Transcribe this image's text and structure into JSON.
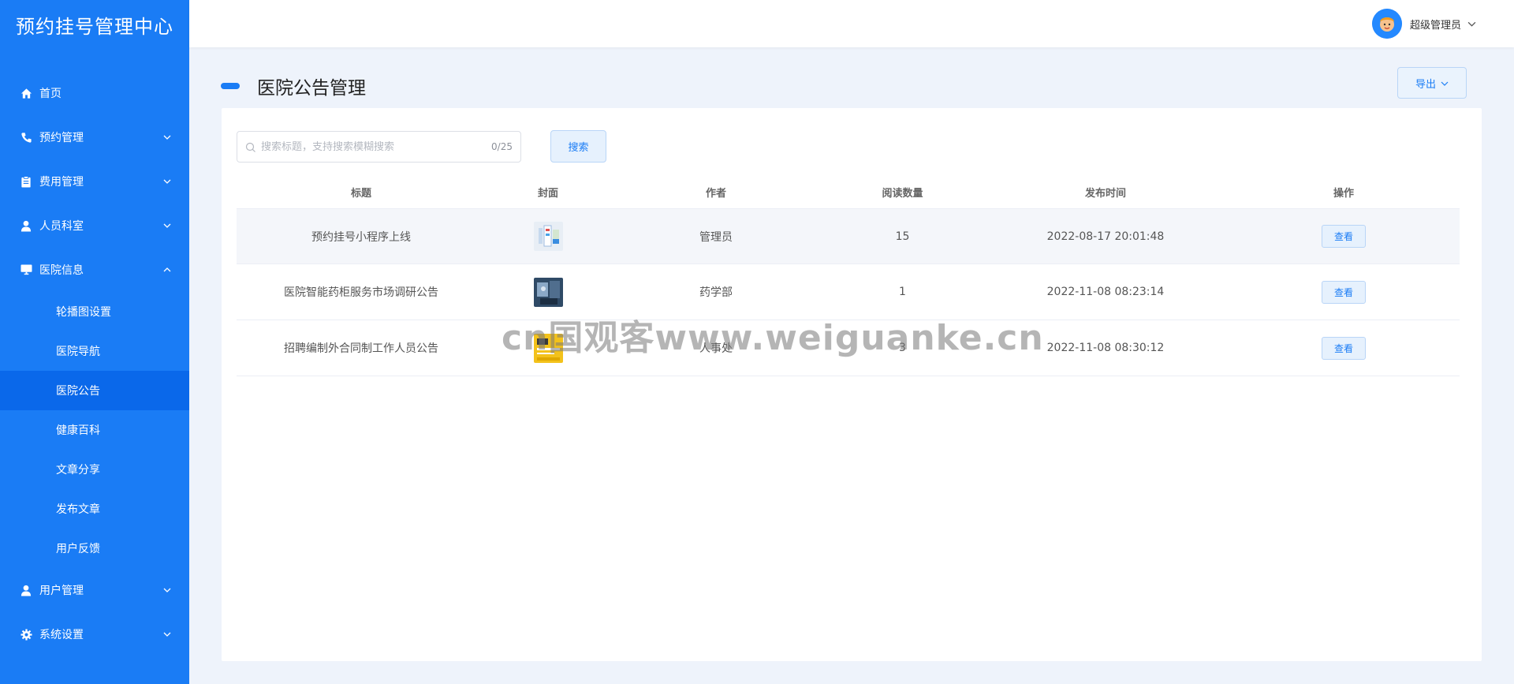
{
  "sidebar": {
    "brand": "预约挂号管理中心",
    "items": [
      {
        "label": "首页",
        "icon": "home-icon"
      },
      {
        "label": "预约管理",
        "icon": "phone-icon"
      },
      {
        "label": "费用管理",
        "icon": "clipboard-icon"
      },
      {
        "label": "人员科室",
        "icon": "user-icon"
      },
      {
        "label": "医院信息",
        "icon": "monitor-icon"
      },
      {
        "label": "用户管理",
        "icon": "user-icon"
      },
      {
        "label": "系统设置",
        "icon": "gear-icon"
      }
    ],
    "sub_items": [
      "轮播图设置",
      "医院导航",
      "医院公告",
      "健康百科",
      "文章分享",
      "发布文章",
      "用户反馈"
    ],
    "active_sub": "医院公告",
    "bg_color": "#1a7cf5",
    "active_color": "#0a68ea"
  },
  "header": {
    "user_name": "超级管理员"
  },
  "page": {
    "title": "医院公告管理",
    "export_label": "导出"
  },
  "search": {
    "placeholder": "搜索标题，支持搜索模糊搜索",
    "count": "0/25",
    "button_label": "搜索"
  },
  "table": {
    "columns": [
      "标题",
      "封面",
      "作者",
      "阅读数量",
      "发布时间",
      "操作"
    ],
    "rows": [
      {
        "title": "预约挂号小程序上线",
        "author": "管理员",
        "reads": "15",
        "time": "2022-08-17 20:01:48",
        "action": "查看",
        "cover_color": "#d9e6f2"
      },
      {
        "title": "医院智能药柜服务市场调研公告",
        "author": "药学部",
        "reads": "1",
        "time": "2022-11-08 08:23:14",
        "action": "查看",
        "cover_color": "#4d6a8a"
      },
      {
        "title": "招聘编制外合同制工作人员公告",
        "author": "人事处",
        "reads": "3",
        "time": "2022-11-08 08:30:12",
        "action": "查看",
        "cover_color": "#f3c21b"
      }
    ]
  },
  "watermark": "cn国观客www.weiguanke.cn"
}
